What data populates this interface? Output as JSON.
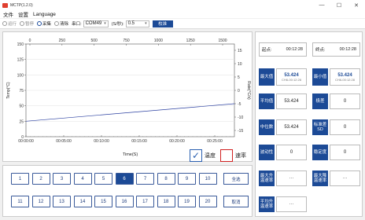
{
  "window": {
    "title": "MCTP(1.2.0)",
    "minimize_glyph": "—",
    "maximize_glyph": "☐",
    "close_glyph": "✕"
  },
  "menu": {
    "items": [
      "文件",
      "设置",
      "Language"
    ]
  },
  "toolbar": {
    "run_label": "运行",
    "stop_label": "暂停",
    "collect_label": "采集",
    "clear_label": "清除",
    "port_label": "串口:",
    "port_value": "COM49",
    "rate_label": "(S/秒):",
    "rate_value": "0.5",
    "test_button": "校准"
  },
  "chart_data": {
    "type": "line",
    "top_axis_ticks": [
      "0",
      "250",
      "500",
      "750",
      "1000",
      "1250",
      "1500"
    ],
    "x_ticks": [
      "00:00:00",
      "00:05:00",
      "00:10:00",
      "00:15:00",
      "00:20:00",
      "00:25:00"
    ],
    "y_left_ticks": [
      "150",
      "125",
      "100",
      "75",
      "50",
      "25",
      "0"
    ],
    "y_right_ticks": [
      "15",
      "10",
      "5",
      "0",
      "-5",
      "-10",
      "-15"
    ],
    "ylabel_left": "Temp(°C)",
    "ylabel_right": "Rate(°C/s)",
    "xlabel": "Time(S)",
    "ylim_left": [
      0,
      150
    ],
    "ylim_right": [
      -15,
      15
    ],
    "series": [
      {
        "name": "温度",
        "color": "#2a3fa0",
        "start": 25,
        "end": 53.4
      },
      {
        "name": "速率",
        "color": "#d02020",
        "start": 0,
        "end": 0
      }
    ],
    "legend": [
      {
        "label": "温度",
        "checked": true,
        "color": "#2a5fb0",
        "mark": "✓"
      },
      {
        "label": "速率",
        "checked": false,
        "color": "#d02020",
        "mark": ""
      }
    ]
  },
  "numbers": {
    "row1": [
      "1",
      "2",
      "3",
      "4",
      "5",
      "6",
      "7",
      "8",
      "9",
      "10"
    ],
    "row2": [
      "11",
      "12",
      "13",
      "14",
      "15",
      "16",
      "17",
      "18",
      "19",
      "20"
    ],
    "selected": "6",
    "select_all": "全选",
    "cancel": "取消"
  },
  "stats": {
    "start_label": "起点:",
    "start_value": "00:12:28",
    "end_label": "终点:",
    "end_value": "00:12:28",
    "max_label": "最大值",
    "max_value": "53.424",
    "max_sub": "CH6-00:12:28",
    "min_label": "最小值",
    "min_value": "53.424",
    "min_sub": "CH6-00:12:28",
    "avg_label": "平均值",
    "avg_value": "53.424",
    "range_label": "极差",
    "range_value": "0",
    "median_label": "中位数",
    "median_value": "53.424",
    "sd_label": "标准差\nSD",
    "sd_value": "0",
    "skew_label": "波动性",
    "skew_value": "0",
    "kurt_label": "稳定度",
    "kurt_value": "0",
    "max_up_label": "最大升\n温速率",
    "max_up_value": "···",
    "max_down_label": "最大降\n温速率",
    "max_down_value": "···",
    "avg_up_label": "平均升\n温速率",
    "avg_up_value": "···"
  }
}
